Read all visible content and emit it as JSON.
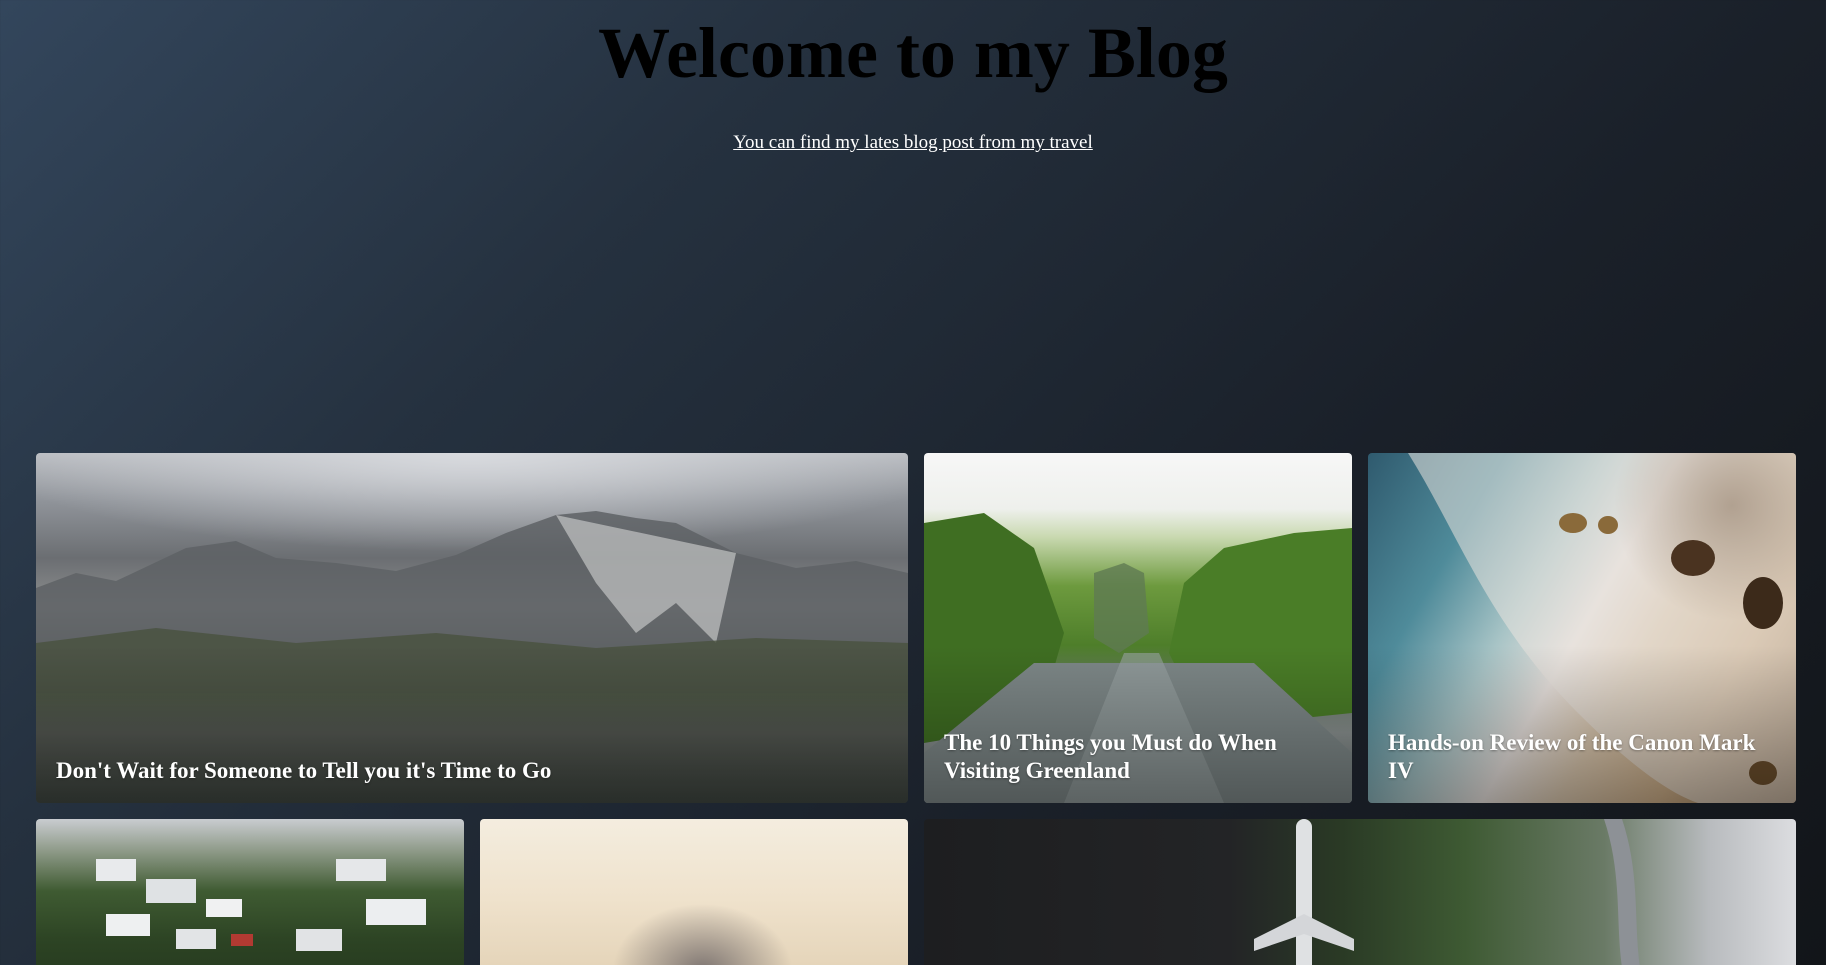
{
  "header": {
    "title": "Welcome to my Blog",
    "subtitle_link": "You can find my lates blog post from my travel"
  },
  "posts": [
    {
      "caption": "Don't Wait for Someone to Tell you it's Time to Go",
      "image": "mountain-range-photo"
    },
    {
      "caption": "The 10 Things you Must do When Visiting Greenland",
      "image": "green-canyon-river-photo"
    },
    {
      "caption": "Hands-on Review of the Canon Mark IV",
      "image": "aerial-beach-photo"
    },
    {
      "caption": "",
      "image": "hillside-houses-photo"
    },
    {
      "caption": "",
      "image": "mountain-peak-sunset-photo"
    },
    {
      "caption": "",
      "image": "aerial-airplane-photo"
    }
  ],
  "colors": {
    "background_start": "#33465c",
    "background_end": "#121519",
    "title": "#000000",
    "link": "#ffffff",
    "caption": "#ffffff"
  }
}
